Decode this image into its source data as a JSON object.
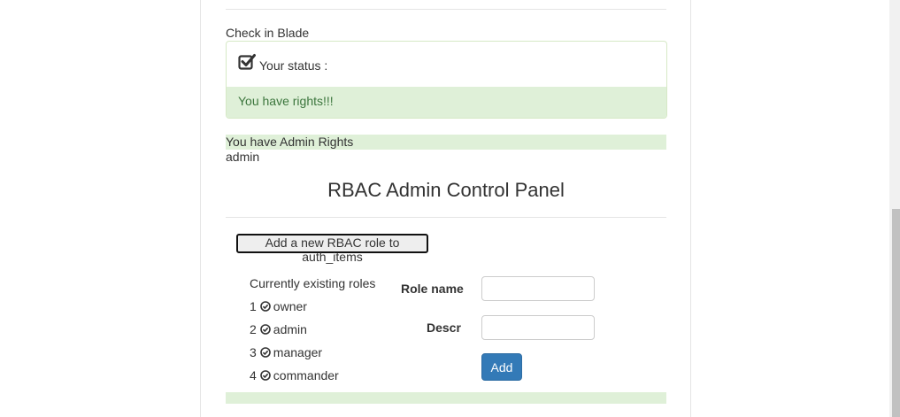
{
  "blade_section": {
    "label": "Check in Blade",
    "status_label": "Your status :",
    "status_message": "You have rights!!!"
  },
  "admin_rights_text": "You have Admin Rights",
  "username": "admin",
  "control_panel": {
    "title": "RBAC Admin Control Panel",
    "add_role_button_label": "Add a new RBAC role to auth_items",
    "roles_heading": "Currently existing roles",
    "roles": [
      {
        "number": "1",
        "name": "owner"
      },
      {
        "number": "2",
        "name": "admin"
      },
      {
        "number": "3",
        "name": "manager"
      },
      {
        "number": "4",
        "name": "commander"
      }
    ],
    "form": {
      "role_name_label": "Role name",
      "role_name_value": "",
      "descr_label": "Descr",
      "descr_value": "",
      "submit_label": "Add"
    }
  },
  "colors": {
    "success_bg": "#dff0d8",
    "success_text": "#3c763d",
    "primary": "#337ab7"
  },
  "icons": {
    "status_checkbox": "checked-checkbox-icon",
    "role_marker": "check-circle-icon"
  }
}
